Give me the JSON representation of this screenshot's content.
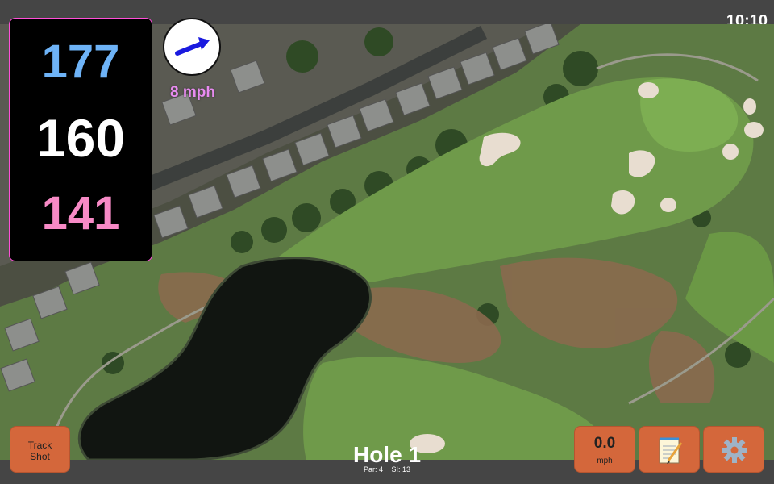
{
  "status": {
    "time": "10:10"
  },
  "distances": {
    "back": "177",
    "middle": "160",
    "front": "141"
  },
  "wind": {
    "speed_label": "8 mph",
    "direction_icon": "arrow-icon"
  },
  "buttons": {
    "track_shot_line1": "Track",
    "track_shot_line2": "Shot",
    "wind_value": "0.0",
    "wind_unit": "mph",
    "notes_icon": "notepad-icon",
    "settings_icon": "gear-icon"
  },
  "hole": {
    "title": "Hole 1",
    "par": "Par: 4",
    "si": "SI: 13"
  },
  "colors": {
    "back_distance": "#6eb3f7",
    "mid_distance": "#ffffff",
    "front_distance": "#f78ac6",
    "button": "#d4673b",
    "wind_arrow": "#1a1adf"
  }
}
